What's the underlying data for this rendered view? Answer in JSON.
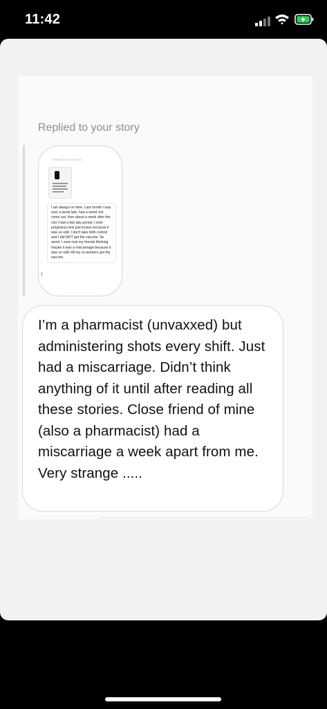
{
  "status_bar": {
    "time": "11:42"
  },
  "dm": {
    "reply_label": "Replied to your story",
    "story_preview": {
      "header": "Replied to your story",
      "text": "I am always on time. Last month I was over a week late, had a weird clot come out, then about a week after the clot I had a two day period. I took pregnancy test just incase because it was so odd. I don't take birth control and I did NOT get the vaccine. So weird. I even text my friends thinking maybe it was a miscarriage because it was so odd. All my co-workers got the vaccine."
    },
    "message": "I’m a pharmacist (unvaxxed) but administering shots every shift. Just had a miscarriage. Didn’t think anything of it until after reading all these stories. Close friend of mine (also a pharmacist) had a miscarriage a week apart from me. Very strange ....."
  }
}
